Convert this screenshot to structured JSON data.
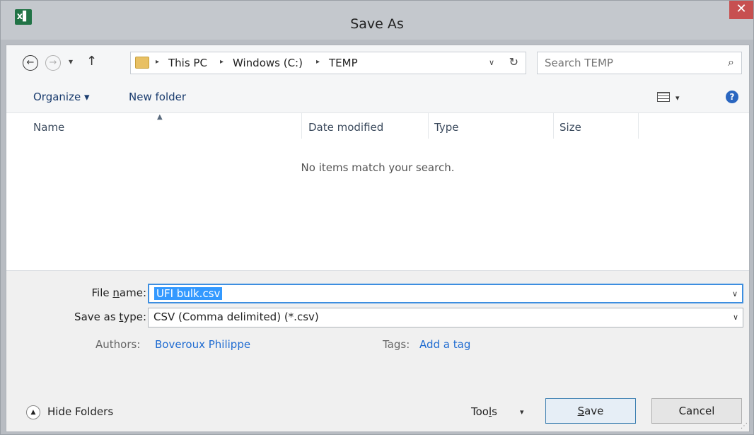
{
  "window": {
    "title": "Save As",
    "app_icon_text": "x▌",
    "close_glyph": "✕"
  },
  "nav": {
    "back_glyph": "←",
    "forward_glyph": "→",
    "recent_glyph": "▾",
    "up_glyph": "↑"
  },
  "address": {
    "breadcrumbs": [
      "This PC",
      "Windows (C:)",
      "TEMP"
    ],
    "separator": "▸",
    "dropdown_glyph": "∨",
    "refresh_glyph": "↻"
  },
  "search": {
    "placeholder": "Search TEMP",
    "icon_glyph": "⌕"
  },
  "toolbar": {
    "organize_label": "Organize ▾",
    "new_folder_label": "New folder",
    "view_dropdown_glyph": "▾",
    "help_glyph": "?"
  },
  "file_list": {
    "columns": [
      "Name",
      "Date modified",
      "Type",
      "Size"
    ],
    "sort_glyph": "▲",
    "empty_message": "No items match your search."
  },
  "form": {
    "file_name_label_pre": "File ",
    "file_name_label_underline": "n",
    "file_name_label_post": "ame:",
    "file_name_value": "UFI bulk.csv",
    "save_type_label_pre": "Save as ",
    "save_type_label_underline": "t",
    "save_type_label_post": "ype:",
    "save_type_value": "CSV (Comma delimited) (*.csv)",
    "dropdown_glyph": "∨",
    "authors_label": "Authors:",
    "authors_value": "Boveroux Philippe",
    "tags_label": "Tags:",
    "tags_value": "Add a tag"
  },
  "footer": {
    "hide_folders_label": "Hide Folders",
    "hide_folders_glyph": "▲",
    "tools_label_pre": "Too",
    "tools_label_underline": "l",
    "tools_label_post": "s",
    "tools_dropdown_glyph": "▾",
    "save_label_underline": "S",
    "save_label_post": "ave",
    "cancel_label": "Cancel",
    "grip_glyph": "⋰"
  },
  "colors": {
    "accent": "#3d8ee0",
    "selection": "#3399ff",
    "close": "#c75050",
    "link": "#1e6bd1"
  }
}
